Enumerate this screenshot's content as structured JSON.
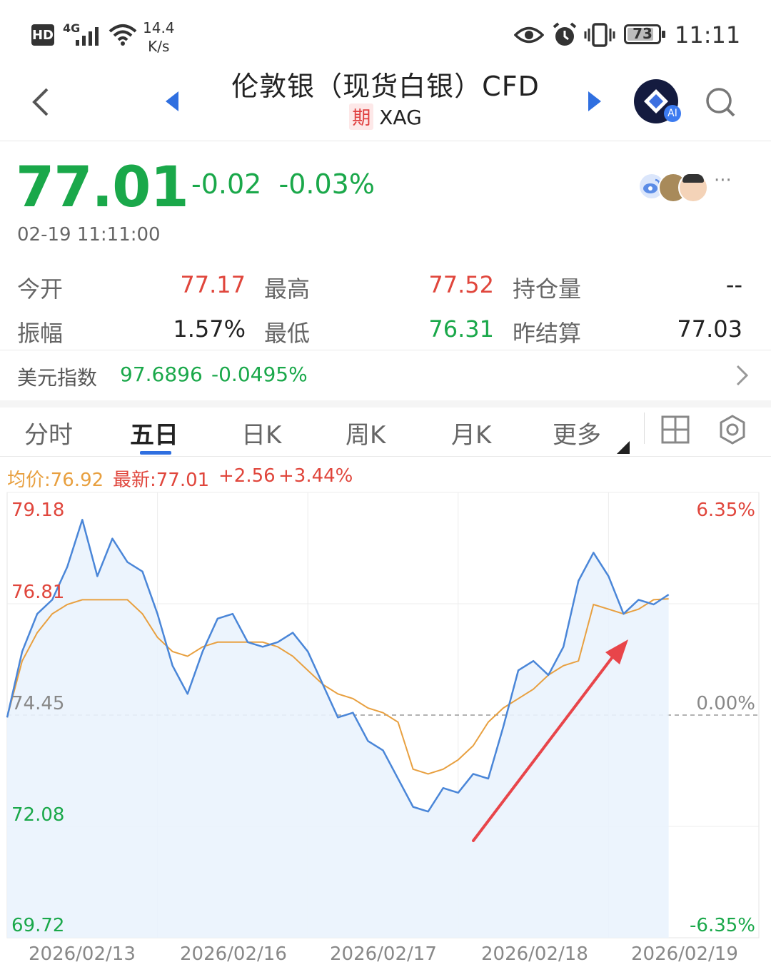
{
  "status_bar": {
    "hd": "HD",
    "network": "4G",
    "speed_value": "14.4",
    "speed_unit": "K/s",
    "battery": "73",
    "time": "11:11"
  },
  "header": {
    "title": "伦敦银（现货白银）CFD",
    "badge": "期",
    "symbol": "XAG",
    "ai_badge": "AI"
  },
  "quote": {
    "price": "77.01",
    "change": "-0.02",
    "change_pct": "-0.03%",
    "timestamp": "02-19 11:11:00",
    "more": "···",
    "stats": [
      {
        "label": "今开",
        "value": "77.17",
        "color": "red"
      },
      {
        "label": "最高",
        "value": "77.52",
        "color": "red"
      },
      {
        "label": "持仓量",
        "value": "--",
        "color": "dark"
      },
      {
        "label": "振幅",
        "value": "1.57%",
        "color": "dark"
      },
      {
        "label": "最低",
        "value": "76.31",
        "color": "green"
      },
      {
        "label": "昨结算",
        "value": "77.03",
        "color": "dark"
      }
    ]
  },
  "usd_index": {
    "label": "美元指数",
    "value": "97.6896",
    "change_pct": "-0.0495%"
  },
  "tabs": [
    "分时",
    "五日",
    "日K",
    "周K",
    "月K",
    "更多"
  ],
  "active_tab": "五日",
  "chart_legend": {
    "avg": "均价:76.92",
    "latest": "最新:77.01",
    "change": "+2.56",
    "change_pct": "+3.44%"
  },
  "colors": {
    "up": "#e0463c",
    "down": "#1aa84a",
    "price_line": "#4a86d8",
    "avg_line": "#e8a040",
    "arrow": "#e8454a"
  },
  "chart_data": {
    "type": "line",
    "title": "",
    "xlabel": "",
    "ylabel": "",
    "x_tick_labels": [
      "2026/02/13",
      "2026/02/16",
      "2026/02/17",
      "2026/02/18",
      "2026/02/19"
    ],
    "y_tick_labels_left": [
      "79.18",
      "76.81",
      "74.45",
      "72.08",
      "69.72"
    ],
    "y_tick_labels_right": [
      "6.35%",
      "",
      "0.00%",
      "",
      "-6.35%"
    ],
    "ylim": [
      69.72,
      79.18
    ],
    "baseline": 74.45,
    "grid": true,
    "series": [
      {
        "name": "最新",
        "x": [
          0,
          0.1,
          0.2,
          0.3,
          0.4,
          0.5,
          0.6,
          0.7,
          0.8,
          0.9,
          1.0,
          1.1,
          1.2,
          1.3,
          1.4,
          1.5,
          1.6,
          1.7,
          1.8,
          1.9,
          2.0,
          2.1,
          2.2,
          2.3,
          2.4,
          2.5,
          2.6,
          2.7,
          2.8,
          2.9,
          3.0,
          3.1,
          3.2,
          3.3,
          3.4,
          3.5,
          3.6,
          3.7,
          3.8,
          3.9,
          4.0,
          4.1,
          4.2,
          4.3,
          4.4,
          4.5,
          4.6,
          4.7,
          4.8,
          4.9,
          5.0
        ],
        "values": [
          74.4,
          75.8,
          76.6,
          76.9,
          77.6,
          78.6,
          77.4,
          78.2,
          77.7,
          77.5,
          76.6,
          75.5,
          74.9,
          75.8,
          76.5,
          76.6,
          76.0,
          75.9,
          76.0,
          76.2,
          75.8,
          75.1,
          74.4,
          74.5,
          73.9,
          73.7,
          73.1,
          72.5,
          72.4,
          72.9,
          72.8,
          73.2,
          73.1,
          74.2,
          75.4,
          75.6,
          75.3,
          75.9,
          77.3,
          77.9,
          77.4,
          76.6,
          76.9,
          76.8,
          77.01,
          null,
          null,
          null,
          null,
          null,
          null
        ]
      },
      {
        "name": "均价",
        "x": [
          0,
          0.1,
          0.2,
          0.3,
          0.4,
          0.5,
          0.6,
          0.7,
          0.8,
          0.9,
          1.0,
          1.1,
          1.2,
          1.3,
          1.4,
          1.5,
          1.6,
          1.7,
          1.8,
          1.9,
          2.0,
          2.1,
          2.2,
          2.3,
          2.4,
          2.5,
          2.6,
          2.7,
          2.8,
          2.9,
          3.0,
          3.1,
          3.2,
          3.3,
          3.4,
          3.5,
          3.6,
          3.7,
          3.8,
          3.9,
          4.0,
          4.1,
          4.2,
          4.3,
          4.4,
          4.5,
          4.6,
          4.7,
          4.8,
          4.9,
          5.0
        ],
        "values": [
          74.4,
          75.6,
          76.2,
          76.6,
          76.8,
          76.9,
          76.9,
          76.9,
          76.9,
          76.6,
          76.1,
          75.8,
          75.7,
          75.9,
          76.0,
          76.0,
          76.0,
          76.0,
          75.9,
          75.7,
          75.4,
          75.1,
          74.9,
          74.8,
          74.6,
          74.5,
          74.3,
          73.3,
          73.2,
          73.3,
          73.5,
          73.8,
          74.3,
          74.6,
          74.8,
          75.0,
          75.3,
          75.5,
          75.6,
          76.8,
          76.7,
          76.6,
          76.7,
          76.9,
          76.92,
          null,
          null,
          null,
          null,
          null,
          null
        ]
      }
    ]
  }
}
